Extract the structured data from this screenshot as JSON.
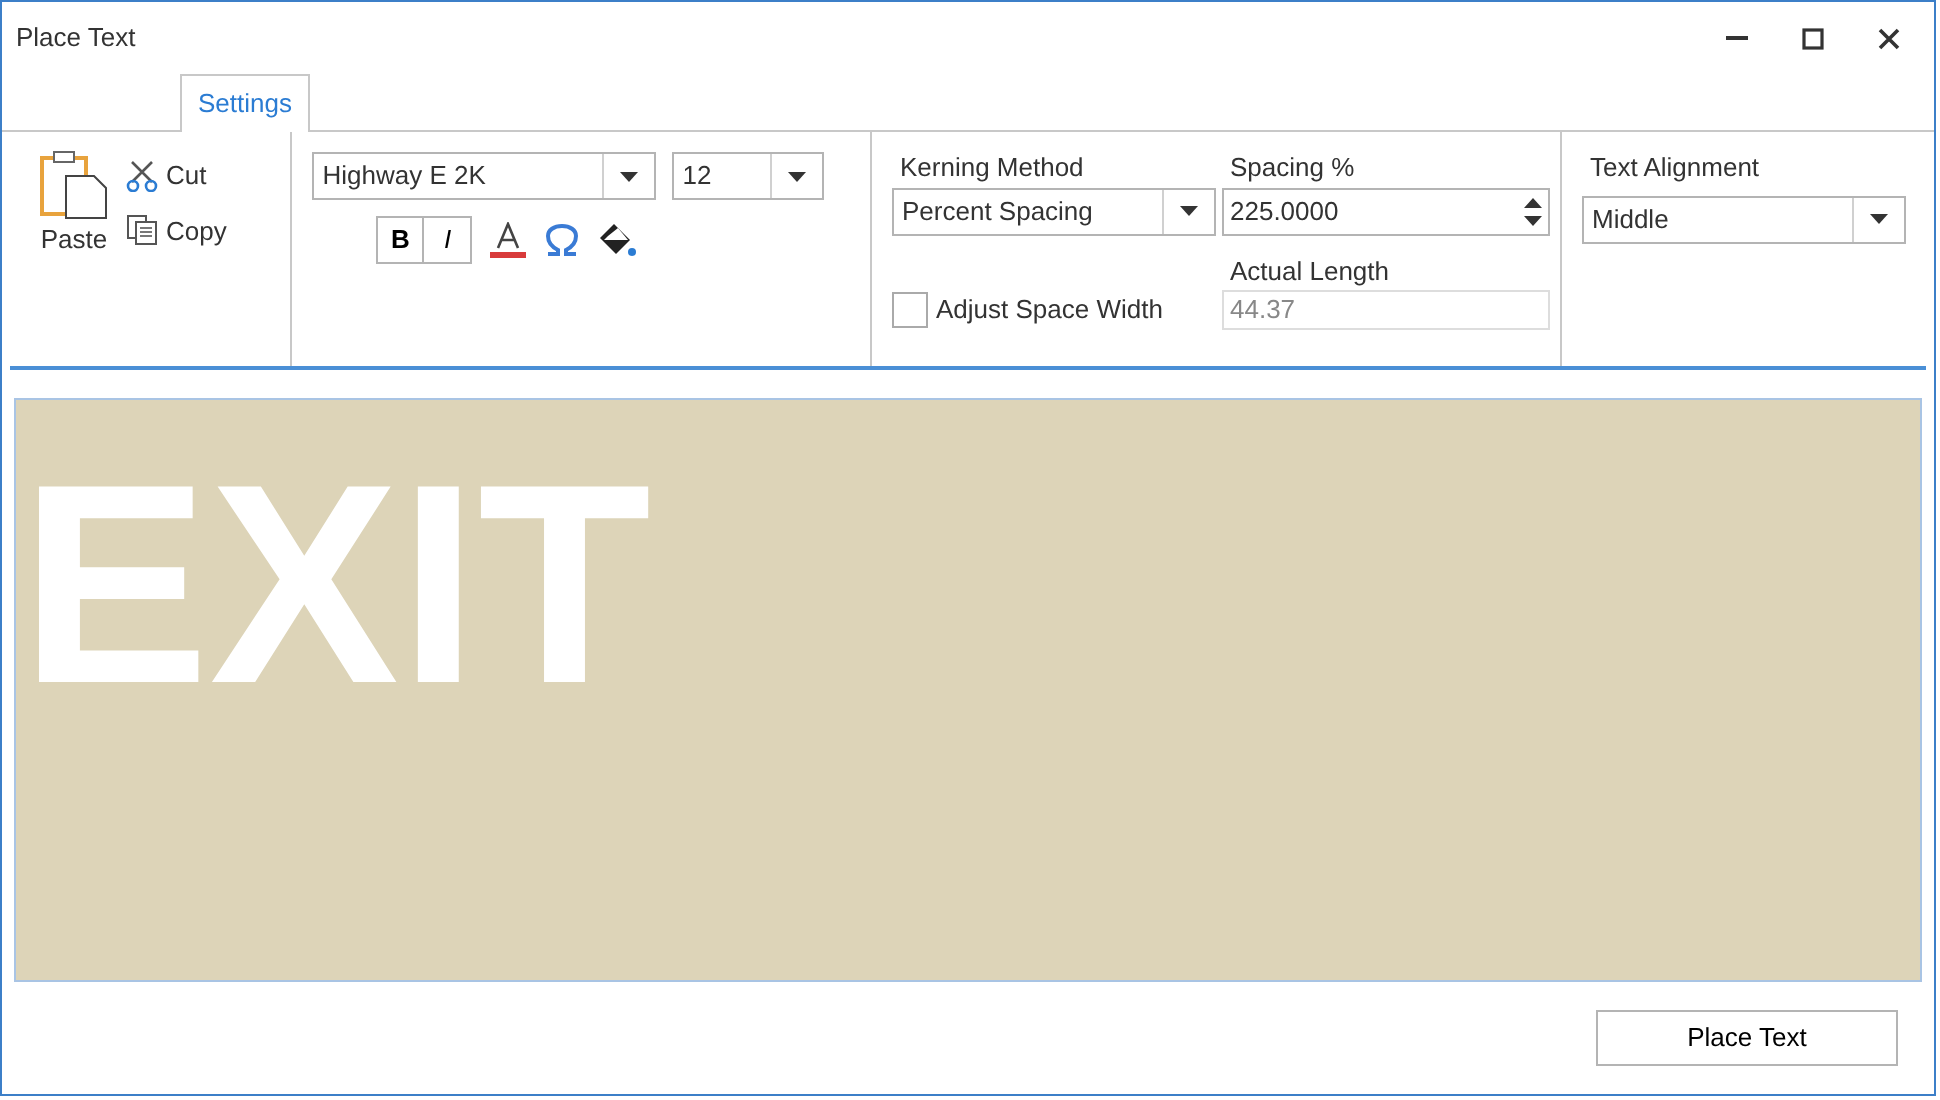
{
  "window": {
    "title": "Place Text"
  },
  "tabs": [
    {
      "label": "Settings",
      "selected": true
    }
  ],
  "clipboard": {
    "paste": "Paste",
    "cut": "Cut",
    "copy": "Copy"
  },
  "font": {
    "family": "Highway E 2K",
    "size": "12",
    "bold_label": "B",
    "italic_label": "I"
  },
  "kerning": {
    "method_label": "Kerning Method",
    "method": "Percent Spacing",
    "spacing_label": "Spacing %",
    "spacing": "225.0000",
    "length_label": "Actual Length",
    "length": "44.37",
    "length_disabled": true,
    "adjust_label": "Adjust Space Width",
    "adjust_checked": false
  },
  "alignment": {
    "label": "Text Alignment",
    "value": "Middle"
  },
  "preview": {
    "text": "EXIT"
  },
  "buttons": [
    "Place Text"
  ]
}
